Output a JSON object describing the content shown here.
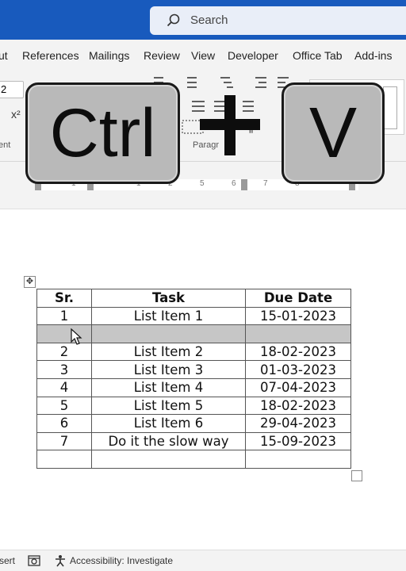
{
  "search": {
    "label": "Search"
  },
  "ribbon_tabs": [
    "ut",
    "References",
    "Mailings",
    "Review",
    "View",
    "Developer",
    "Office Tab",
    "Add-ins"
  ],
  "ribbon": {
    "font_group_label": "ent",
    "paragraph_group_label": "Paragr",
    "superscript_label": "x²",
    "font_size_value": "2"
  },
  "ruler": {
    "numbers": [
      "1",
      "1",
      "2",
      "3",
      "4",
      "5",
      "6",
      "7",
      "8"
    ]
  },
  "table": {
    "headers": [
      "Sr.",
      "Task",
      "Due Date"
    ],
    "rows": [
      [
        "1",
        "List Item 1",
        "15-01-2023"
      ],
      [
        "",
        "",
        ""
      ],
      [
        "2",
        "List Item 2",
        "18-02-2023"
      ],
      [
        "3",
        "List Item 3",
        "01-03-2023"
      ],
      [
        "4",
        "List Item 4",
        "07-04-2023"
      ],
      [
        "5",
        "List Item 5",
        "18-02-2023"
      ],
      [
        "6",
        "List Item 6",
        "29-04-2023"
      ],
      [
        "7",
        "Do it the slow way",
        "15-09-2023"
      ],
      [
        "",
        "",
        ""
      ]
    ],
    "selected_row_index": 1
  },
  "statusbar": {
    "insert_label": "sert",
    "accessibility_label": "Accessibility: Investigate"
  },
  "overlay": {
    "key1": "Ctrl",
    "key2": "V"
  },
  "colors": {
    "titlebar": "#185abd",
    "selection": "#c6c6c6"
  }
}
